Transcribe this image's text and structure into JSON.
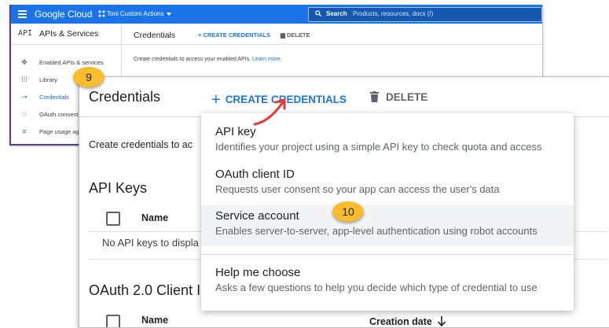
{
  "small_window": {
    "topbar": {
      "logo": "Google Cloud",
      "project": "Toni Custom Actions",
      "search_label": "Search",
      "search_placeholder": "Products, resources, docs (/)"
    },
    "sidebar": {
      "api_badge": "API",
      "title": "APIs & Services",
      "items": [
        {
          "label": "Enabled APIs & services",
          "icon": "hub-icon"
        },
        {
          "label": "Library",
          "icon": "grid-icon"
        },
        {
          "label": "Credentials",
          "icon": "key-icon",
          "active": true
        },
        {
          "label": "OAuth consent",
          "icon": "consent-icon"
        },
        {
          "label": "Page usage agr",
          "icon": "settings-list-icon"
        }
      ]
    },
    "content": {
      "title": "Credentials",
      "create_label": "+ CREATE CREDENTIALS",
      "delete_label": "DELETE",
      "description": "Create credentials to access your enabled APIs.",
      "learn_more": "Learn more"
    }
  },
  "badges": {
    "step9": "9",
    "step10": "10"
  },
  "big_window": {
    "title": "Credentials",
    "create_label": "CREATE CREDENTIALS",
    "delete_label": "DELETE",
    "description": "Create credentials to ac",
    "api_keys_heading": "API Keys",
    "table_name_header": "Name",
    "no_keys": "No API keys to displa",
    "oauth_heading": "OAuth 2.0 Client I",
    "table2_name_header": "Name",
    "table2_created_header": "Creation date"
  },
  "menu": {
    "items": [
      {
        "title": "API key",
        "description": "Identifies your project using a simple API key to check quota and access"
      },
      {
        "title": "OAuth client ID",
        "description": "Requests user consent so your app can access the user's data"
      },
      {
        "title": "Service account",
        "description": "Enables server-to-server, app-level authentication using robot accounts"
      },
      {
        "title": "Help me choose",
        "description": "Asks a few questions to help you decide which type of credential to use"
      }
    ]
  },
  "colors": {
    "accent": "#1a73e8",
    "badge": "#fbbd2e",
    "arrow": "#e53935",
    "frame": "#5f3a8a"
  }
}
